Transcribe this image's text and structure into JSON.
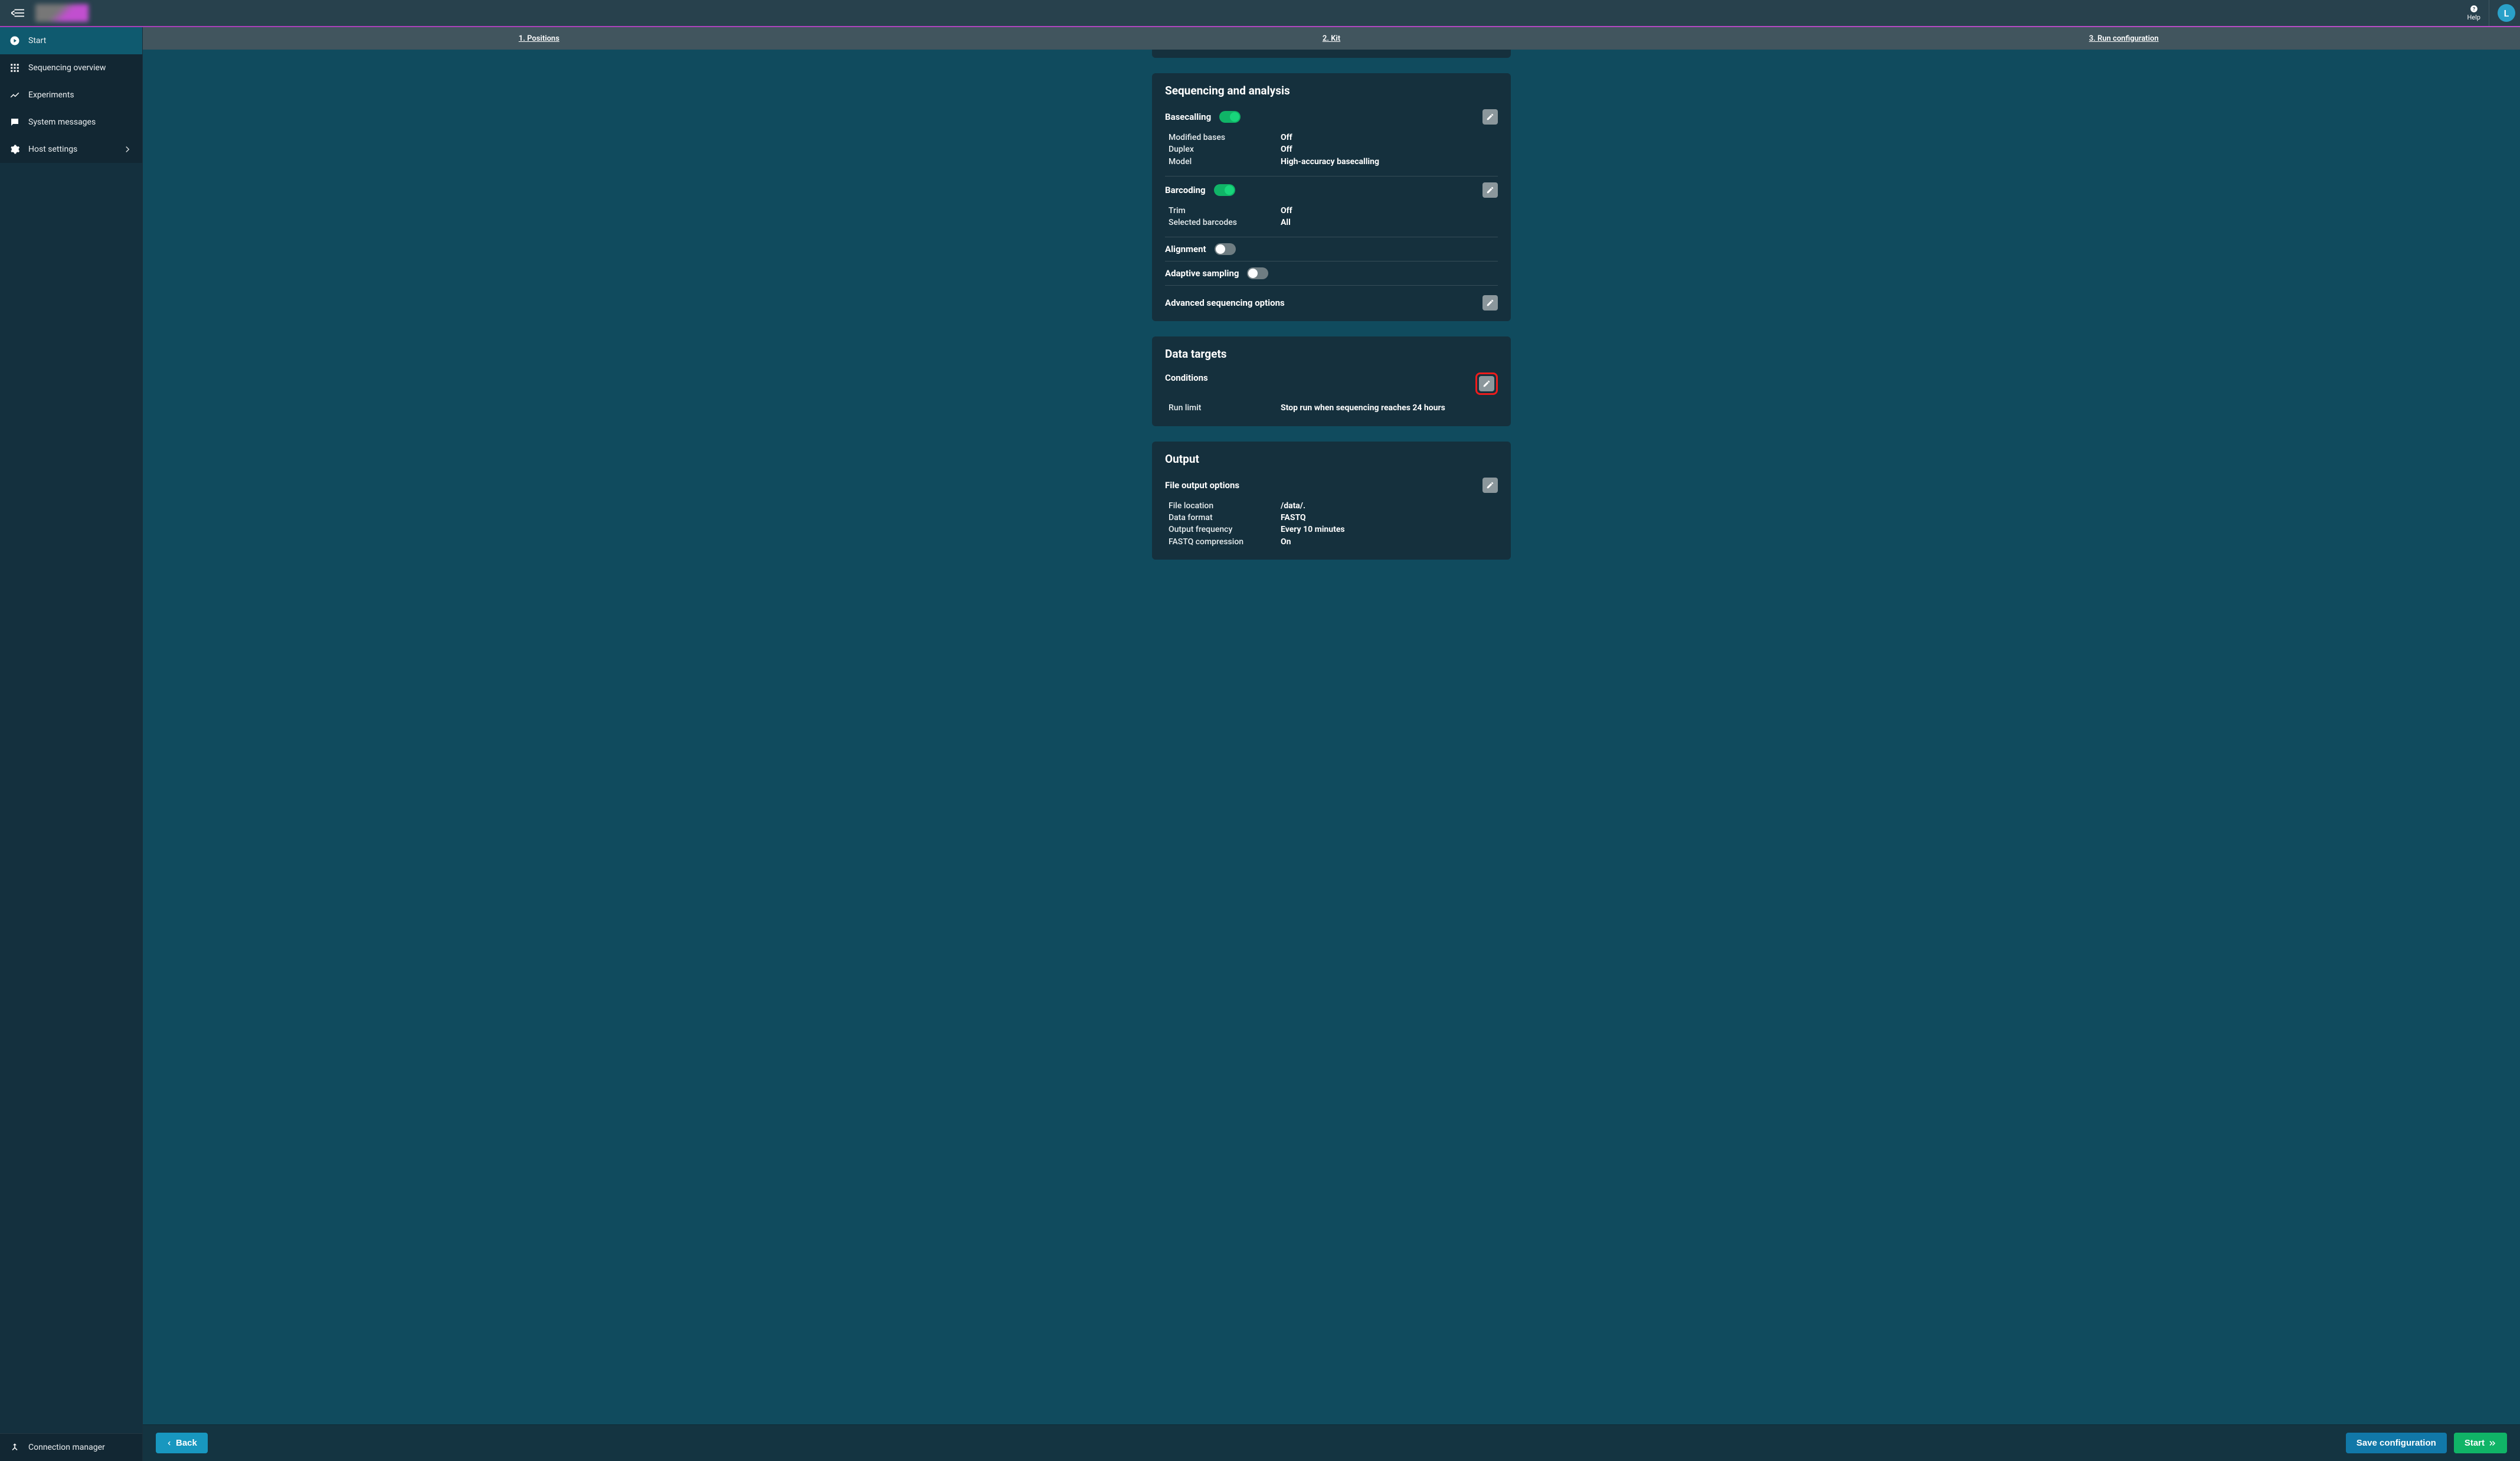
{
  "topbar": {
    "help_label": "Help",
    "avatar_initial": "L"
  },
  "sidebar": {
    "items": [
      {
        "label": "Start"
      },
      {
        "label": "Sequencing overview"
      },
      {
        "label": "Experiments"
      },
      {
        "label": "System messages"
      },
      {
        "label": "Host settings"
      }
    ],
    "bottom": {
      "label": "Connection manager"
    }
  },
  "steps": [
    {
      "label": "1. Positions"
    },
    {
      "label": "2. Kit"
    },
    {
      "label": "3. Run configuration"
    }
  ],
  "seq_analysis": {
    "heading": "Sequencing and analysis",
    "basecalling": {
      "title": "Basecalling",
      "on": true,
      "rows": [
        {
          "k": "Modified bases",
          "v": "Off"
        },
        {
          "k": "Duplex",
          "v": "Off"
        },
        {
          "k": "Model",
          "v": "High-accuracy basecalling"
        }
      ]
    },
    "barcoding": {
      "title": "Barcoding",
      "on": true,
      "rows": [
        {
          "k": "Trim",
          "v": "Off"
        },
        {
          "k": "Selected barcodes",
          "v": "All"
        }
      ]
    },
    "alignment": {
      "title": "Alignment",
      "on": false
    },
    "adaptive": {
      "title": "Adaptive sampling",
      "on": false
    },
    "advanced": {
      "title": "Advanced sequencing options"
    }
  },
  "data_targets": {
    "heading": "Data targets",
    "conditions_title": "Conditions",
    "rows": [
      {
        "k": "Run limit",
        "v": "Stop run when sequencing reaches 24 hours"
      }
    ]
  },
  "output": {
    "heading": "Output",
    "file_options_title": "File output options",
    "rows": [
      {
        "k": "File location",
        "v": "/data/."
      },
      {
        "k": "Data format",
        "v": "FASTQ"
      },
      {
        "k": "Output frequency",
        "v": "Every 10 minutes"
      },
      {
        "k": "FASTQ compression",
        "v": "On"
      }
    ]
  },
  "footer": {
    "back": "Back",
    "save": "Save configuration",
    "start": "Start"
  }
}
